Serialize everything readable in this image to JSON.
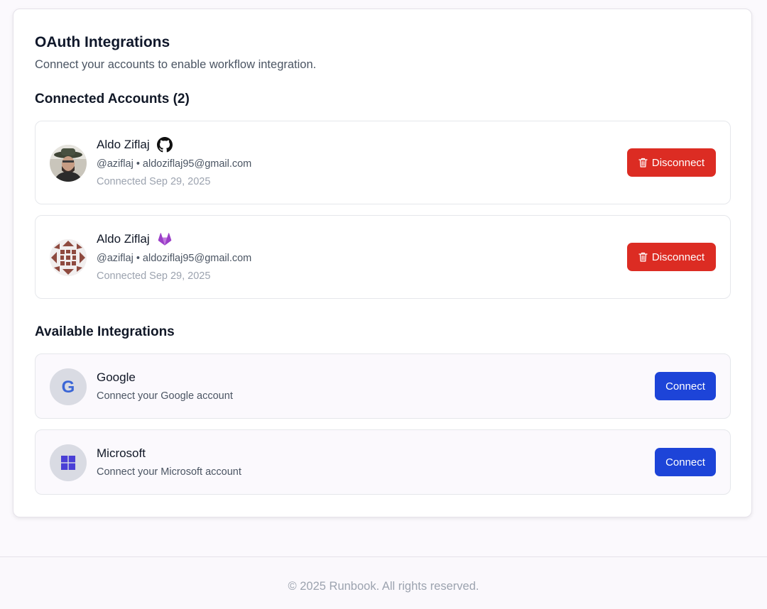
{
  "page": {
    "title": "OAuth Integrations",
    "subtitle": "Connect your accounts to enable workflow integration."
  },
  "connected": {
    "heading": "Connected Accounts (2)",
    "accounts": [
      {
        "name": "Aldo Ziflaj",
        "provider": "github",
        "provider_icon": "github-icon",
        "handle": "@aziflaj • aldoziflaj95@gmail.com",
        "connected": "Connected Sep 29, 2025",
        "action_label": "Disconnect"
      },
      {
        "name": "Aldo Ziflaj",
        "provider": "gitlab",
        "provider_icon": "gitlab-icon",
        "handle": "@aziflaj • aldoziflaj95@gmail.com",
        "connected": "Connected Sep 29, 2025",
        "action_label": "Disconnect"
      }
    ]
  },
  "available": {
    "heading": "Available Integrations",
    "items": [
      {
        "name": "Google",
        "icon": "google-icon",
        "description": "Connect your Google account",
        "action_label": "Connect"
      },
      {
        "name": "Microsoft",
        "icon": "microsoft-icon",
        "description": "Connect your Microsoft account",
        "action_label": "Connect"
      }
    ]
  },
  "footer": {
    "text": "© 2025 Runbook. All rights reserved."
  },
  "colors": {
    "disconnect": "#dc2c23",
    "connect": "#1d44d8",
    "gitlab": "#9b3fc8",
    "google_blue": "#3b66d6",
    "microsoft": "#4a3fd6",
    "avatar_pattern": "#8e4a3f"
  }
}
